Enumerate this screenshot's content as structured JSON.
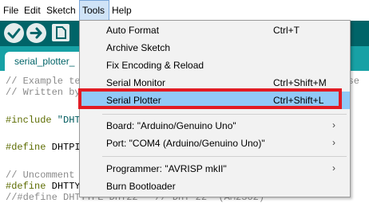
{
  "menubar": {
    "file": "File",
    "edit": "Edit",
    "sketch": "Sketch",
    "tools": "Tools",
    "help": "Help"
  },
  "toolbar": {
    "verify_icon": "check-icon",
    "upload_icon": "arrow-right-icon",
    "new_icon": "new-file-icon"
  },
  "tab": {
    "label": "serial_plotter_"
  },
  "code": {
    "line1": "// Example te",
    "line1_tail": "re se",
    "line2": "// Written by",
    "line3_kw": "#include",
    "line3_str": " \"DHT",
    "line4_kw": "#define",
    "line4_rest": " DHTPI",
    "line5": "// Uncomment",
    "line6_kw": "#define",
    "line6_rest": " DHTTY",
    "line7": "//#define DHTTYPE DHT22   // DHT 22  (AM2302)"
  },
  "tools_menu": {
    "items": [
      {
        "label": "Auto Format",
        "shortcut": "Ctrl+T"
      },
      {
        "label": "Archive Sketch",
        "shortcut": ""
      },
      {
        "label": "Fix Encoding & Reload",
        "shortcut": ""
      },
      {
        "label": "Serial Monitor",
        "shortcut": "Ctrl+Shift+M"
      },
      {
        "label": "Serial Plotter",
        "shortcut": "Ctrl+Shift+L"
      },
      {
        "label": "Board: \"Arduino/Genuino Uno\"",
        "submenu": "›"
      },
      {
        "label": "Port: \"COM4 (Arduino/Genuino Uno)\"",
        "submenu": "›"
      },
      {
        "label": "Programmer: \"AVRISP mkII\"",
        "submenu": "›"
      },
      {
        "label": "Burn Bootloader",
        "shortcut": ""
      }
    ],
    "highlight_color": "#91c9f7",
    "annotation_color": "#e21b23"
  },
  "colors": {
    "toolbar": "#006468",
    "tabstrip": "#17a1a5"
  }
}
